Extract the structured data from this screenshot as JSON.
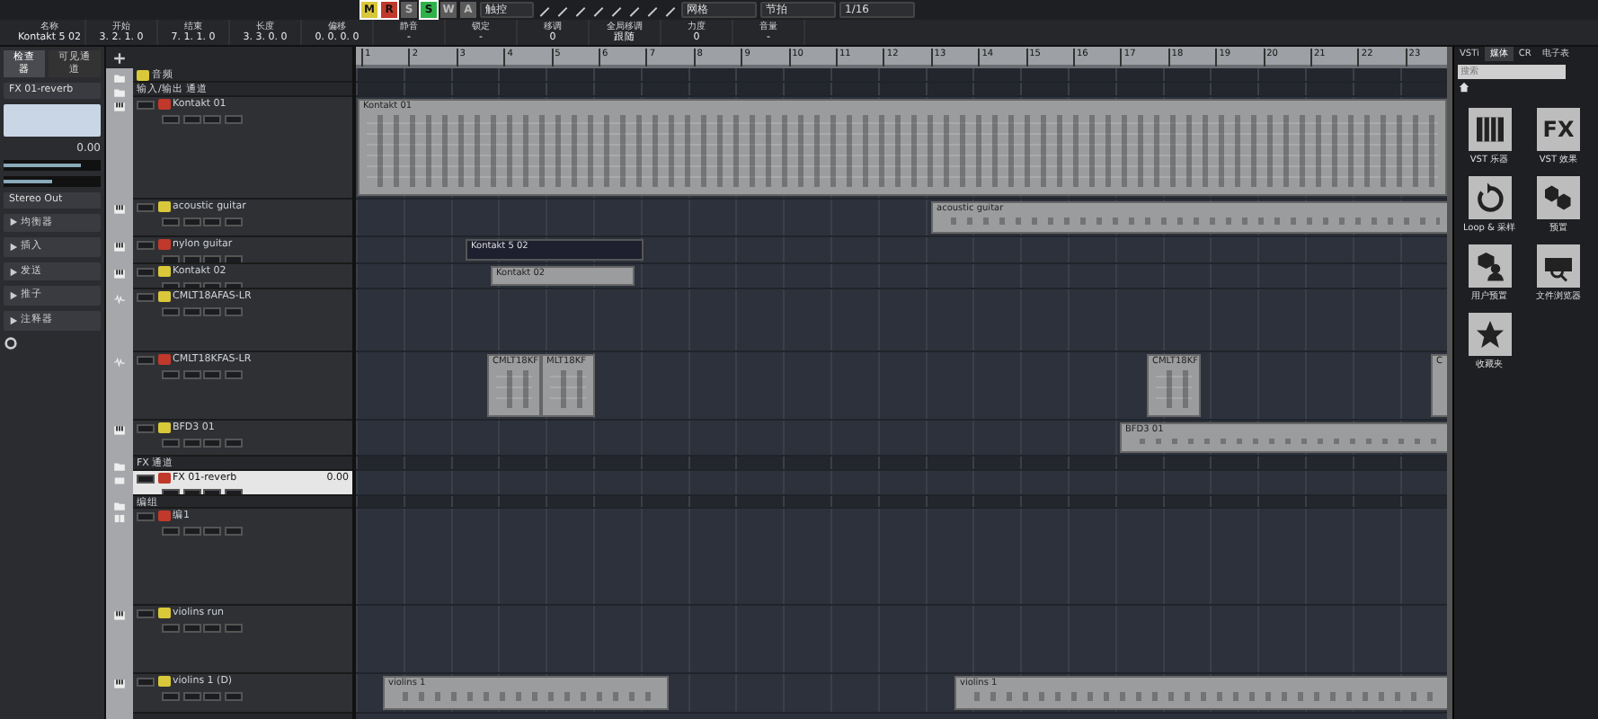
{
  "toolbar": {
    "mode_buttons": [
      {
        "label": "M",
        "on": true,
        "color": "#d9c83a"
      },
      {
        "label": "R",
        "on": true,
        "color": "#c0392b"
      },
      {
        "label": "S",
        "on": false,
        "color": "#5a5a5a"
      },
      {
        "label": "S",
        "on": true,
        "color": "#2fb24a"
      },
      {
        "label": "W",
        "on": false,
        "color": "#5a5a5a"
      },
      {
        "label": "A",
        "on": false,
        "color": "#5a5a5a"
      }
    ],
    "automation_mode": "触控",
    "snap_type": "网格",
    "grid": "节拍",
    "quantize": "1/16"
  },
  "info_line": [
    {
      "label": "名称",
      "value": "Kontakt 5 02"
    },
    {
      "label": "开始",
      "value": "3. 2. 1.  0"
    },
    {
      "label": "结束",
      "value": "7. 1. 1.  0"
    },
    {
      "label": "长度",
      "value": "3. 3. 0.  0"
    },
    {
      "label": "偏移",
      "value": "0. 0. 0.  0"
    },
    {
      "label": "静音",
      "value": "-"
    },
    {
      "label": "锁定",
      "value": "-"
    },
    {
      "label": "移调",
      "value": "0"
    },
    {
      "label": "全局移调",
      "value": "跟随"
    },
    {
      "label": "力度",
      "value": "0"
    },
    {
      "label": "音量",
      "value": "-"
    }
  ],
  "inspector": {
    "tabs": [
      {
        "label": "检查器",
        "selected": true
      },
      {
        "label": "可见通道",
        "selected": false
      }
    ],
    "track_name": "FX 01-reverb",
    "volume_reading": "0.00",
    "volume_fader": {
      "level": 0.8
    },
    "pan_fader": {
      "level": 0.5
    },
    "output": "Stereo Out",
    "sections": [
      {
        "label": "均衡器"
      },
      {
        "label": "插入"
      },
      {
        "label": "发送"
      },
      {
        "label": "推子"
      },
      {
        "label": "注释器"
      }
    ]
  },
  "ruler": [
    "1",
    "2",
    "3",
    "4",
    "5",
    "6",
    "7",
    "8",
    "9",
    "10",
    "11",
    "12",
    "13",
    "14",
    "15",
    "16",
    "17",
    "18",
    "19",
    "20",
    "21",
    "22",
    "23"
  ],
  "tracks": [
    {
      "kind": "folder",
      "name": "音频",
      "selected": false,
      "color": "#d9c83a"
    },
    {
      "kind": "folder",
      "name": "输入/输出 通道",
      "selected": false
    },
    {
      "kind": "instrument",
      "name": "Kontakt 01",
      "selected": false,
      "color": "#c0392b",
      "parts": [
        {
          "name": "Kontakt 01"
        }
      ]
    },
    {
      "kind": "instrument",
      "name": "acoustic guitar",
      "selected": false,
      "color": "#d9c83a",
      "parts": [
        {
          "name": "acoustic guitar"
        }
      ]
    },
    {
      "kind": "instrument",
      "name": "nylon guitar",
      "selected": false,
      "color": "#c0392b",
      "parts": [
        {
          "name": "Kontakt 5 02"
        }
      ]
    },
    {
      "kind": "instrument",
      "name": "Kontakt 02",
      "selected": false,
      "color": "#d9c83a",
      "parts": [
        {
          "name": "Kontakt 02"
        }
      ]
    },
    {
      "kind": "audio",
      "name": "CMLT18AFAS-LR",
      "selected": false,
      "color": "#d9c83a"
    },
    {
      "kind": "audio",
      "name": "CMLT18KFAS-LR",
      "selected": false,
      "color": "#c0392b",
      "parts": [
        {
          "name": "CMLT18KF"
        },
        {
          "name": "MLT18KF"
        },
        {
          "name": "CMLT18KF"
        },
        {
          "name": "C"
        }
      ]
    },
    {
      "kind": "instrument",
      "name": "BFD3 01",
      "selected": false,
      "color": "#d9c83a",
      "parts": [
        {
          "name": "BFD3 01"
        }
      ]
    },
    {
      "kind": "folder",
      "name": "FX 通道",
      "selected": false
    },
    {
      "kind": "fx",
      "name": "FX 01-reverb",
      "selected": true,
      "color": "#c0392b",
      "reading": "0.00"
    },
    {
      "kind": "folder",
      "name": "编组",
      "selected": false
    },
    {
      "kind": "group",
      "name": "编1",
      "selected": false,
      "color": "#c0392b"
    },
    {
      "kind": "instrument",
      "name": "violins run",
      "selected": false,
      "color": "#d9c83a"
    },
    {
      "kind": "instrument",
      "name": "violins 1 (D)",
      "selected": false,
      "color": "#d9c83a",
      "parts": [
        {
          "name": "violins 1"
        },
        {
          "name": "violins 1"
        }
      ]
    }
  ],
  "media_bay": {
    "tabs": [
      {
        "label": "VSTi",
        "selected": false
      },
      {
        "label": "媒体",
        "selected": true
      },
      {
        "label": "CR",
        "selected": false
      },
      {
        "label": "电子表",
        "selected": false
      }
    ],
    "search_placeholder": "搜索",
    "tiles": [
      {
        "kind": "piano",
        "label": "VST 乐器"
      },
      {
        "kind": "loop",
        "label": "Loop & 采样"
      },
      {
        "kind": "user",
        "label": "用户预置"
      },
      {
        "kind": "star",
        "label": "收藏夹"
      },
      {
        "kind": "fx",
        "glyph": "FX",
        "label": "VST 效果"
      },
      {
        "kind": "presets",
        "label": "预置"
      },
      {
        "kind": "browser",
        "label": "文件浏览器"
      }
    ]
  }
}
